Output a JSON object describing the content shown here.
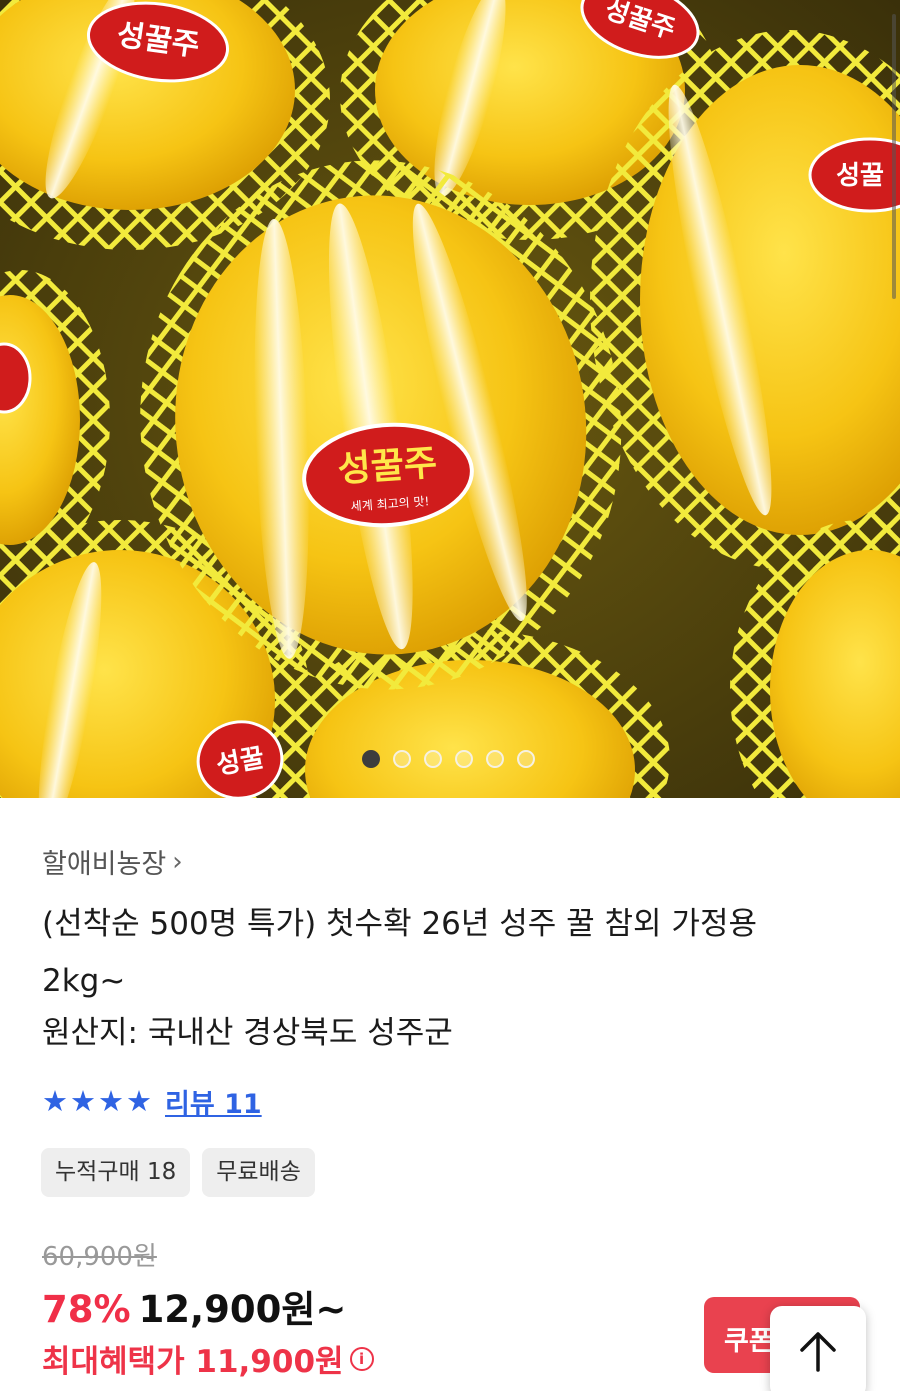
{
  "hero": {
    "image_alt": "",
    "label_brand": "성꿀주",
    "label_tagline": "세계 최고의 맛!",
    "carousel_total": 6,
    "carousel_active": 1
  },
  "seller": {
    "name": "할애비농장",
    "chevron": "›"
  },
  "product": {
    "title_line1": "(선착순 500명 특가) 첫수확 26년 성주 꿀 참외 가정용",
    "title_line2": "2kg~",
    "origin": "원산지: 국내산 경상북도 성주군"
  },
  "rating": {
    "stars": 4,
    "star_icon": "★",
    "review_label": "리뷰 11"
  },
  "chips": [
    {
      "label": "누적구매 18"
    },
    {
      "label": "무료배송"
    }
  ],
  "price": {
    "original": "60,900원",
    "discount": "78%",
    "sale": "12,900원~",
    "benefit": "최대혜택가 11,900원",
    "info_icon": "i"
  },
  "buttons": {
    "coupon": "쿠폰",
    "top_arrow_icon": "arrow-up-icon"
  },
  "colors": {
    "accent_red": "#ef3448",
    "link_blue": "#2f63e3",
    "coupon_bg": "#e9424f"
  }
}
